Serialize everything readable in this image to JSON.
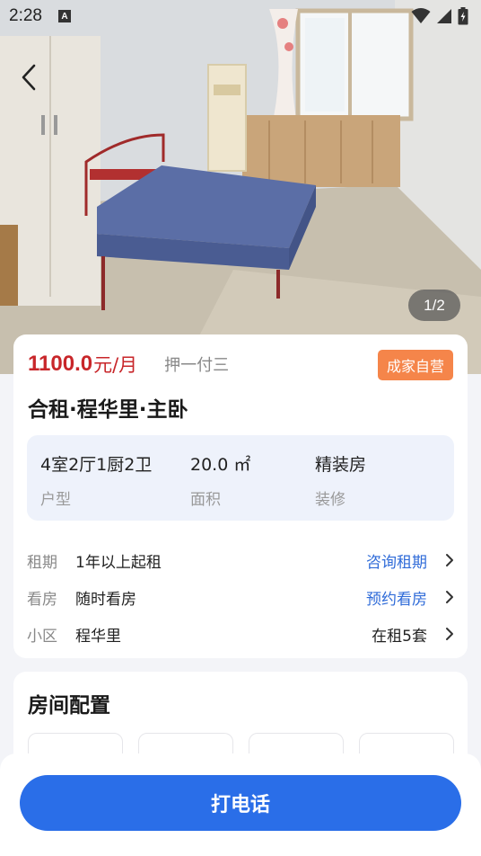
{
  "status_bar": {
    "time": "2:28",
    "notification_badge": "A"
  },
  "gallery": {
    "counter": "1/2"
  },
  "listing": {
    "price": "1100.0",
    "price_unit": "元/月",
    "deposit": "押一付三",
    "badge": "成家自营",
    "title": "合租·程华里·主卧",
    "specs": [
      {
        "value": "4室2厅1厨2卫",
        "label": "户型"
      },
      {
        "value": "20.0 ㎡",
        "label": "面积"
      },
      {
        "value": "精装房",
        "label": "装修"
      }
    ],
    "details": [
      {
        "label": "租期",
        "value": "1年以上起租",
        "action": "咨询租期"
      },
      {
        "label": "看房",
        "value": "随时看房",
        "action": "预约看房"
      },
      {
        "label": "小区",
        "value": "程华里",
        "action": "在租5套"
      }
    ]
  },
  "config": {
    "title": "房间配置"
  },
  "bottom": {
    "call_label": "打电话"
  },
  "colors": {
    "accent": "#2a6ee8",
    "price": "#c8262a",
    "badge": "#f5854a"
  }
}
